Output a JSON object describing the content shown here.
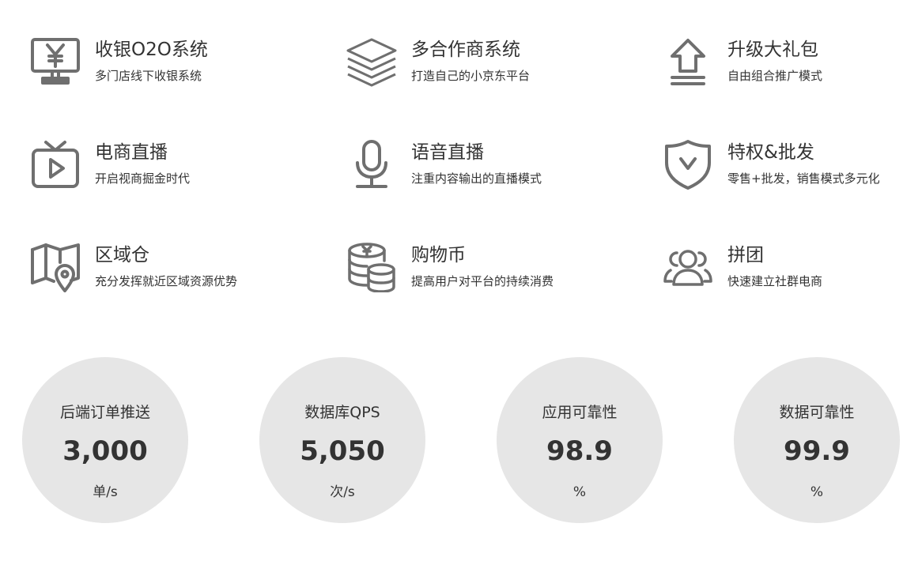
{
  "features": [
    {
      "title": "收银O2O系统",
      "desc": "多门店线下收银系统",
      "icon": "cash-register-icon"
    },
    {
      "title": "多合作商系统",
      "desc": "打造自己的小京东平台",
      "icon": "layers-icon"
    },
    {
      "title": "升级大礼包",
      "desc": "自由组合推广模式",
      "icon": "upgrade-arrow-icon"
    },
    {
      "title": "电商直播",
      "desc": "开启视商掘金时代",
      "icon": "tv-play-icon"
    },
    {
      "title": "语音直播",
      "desc": "注重内容输出的直播模式",
      "icon": "microphone-icon"
    },
    {
      "title": "特权&批发",
      "desc": "零售+批发，销售模式多元化",
      "icon": "shield-icon"
    },
    {
      "title": "区域仓",
      "desc": "充分发挥就近区域资源优势",
      "icon": "map-pin-icon"
    },
    {
      "title": "购物币",
      "desc": "提高用户对平台的持续消费",
      "icon": "coins-icon"
    },
    {
      "title": "拼团",
      "desc": "快速建立社群电商",
      "icon": "group-icon"
    }
  ],
  "stats": [
    {
      "label": "后端订单推送",
      "value": "3,000",
      "unit": "单/s"
    },
    {
      "label": "数据库QPS",
      "value": "5,050",
      "unit": "次/s"
    },
    {
      "label": "应用可靠性",
      "value": "98.9",
      "unit": "%"
    },
    {
      "label": "数据可靠性",
      "value": "99.9",
      "unit": "%"
    }
  ],
  "colors": {
    "icon": "#6f6f6f",
    "text": "#333333",
    "circle": "#e6e6e6"
  }
}
